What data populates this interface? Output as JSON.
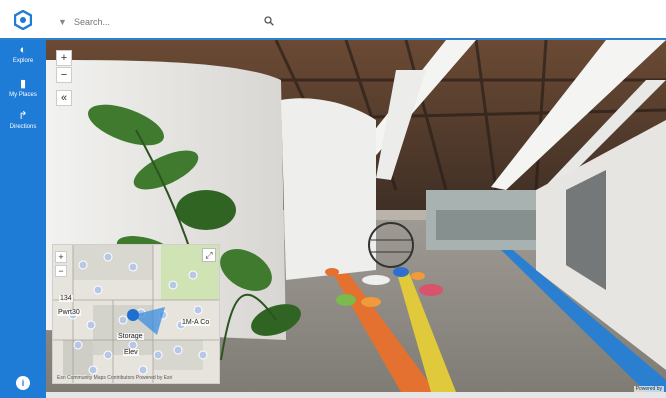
{
  "app": {
    "logo_icon": "location-hexagon-icon"
  },
  "search": {
    "placeholder": "Search...",
    "filter_icon": "filter-icon",
    "search_icon": "search-icon"
  },
  "sidebar": {
    "items": [
      {
        "label": "Explore",
        "icon": "compass-icon"
      },
      {
        "label": "My Places",
        "icon": "pin-icon"
      },
      {
        "label": "Directions",
        "icon": "route-icon"
      }
    ],
    "info_label": "i"
  },
  "viewer": {
    "zoom_in": "+",
    "zoom_out": "−",
    "collapse": "«",
    "credit": "Powered by"
  },
  "minimap": {
    "zoom_in": "+",
    "zoom_out": "−",
    "labels": [
      "134",
      "Pwrt30",
      "Storage",
      "Elev",
      "1M-A Co"
    ],
    "attribution": "Esri Community Maps Contributors   Powered by Esri"
  },
  "colors": {
    "brand": "#1e7bd6",
    "accent_line": "#2f7fd1"
  }
}
